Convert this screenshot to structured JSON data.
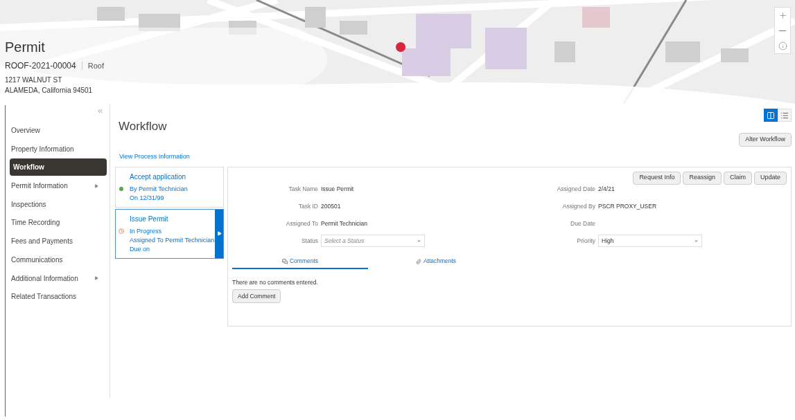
{
  "header": {
    "title": "Permit",
    "permit_number": "ROOF-2021-00004",
    "permit_type": "Roof",
    "address_line_1": "1217 WALNUT ST",
    "address_line_2": "ALAMEDA, California 94501"
  },
  "map_controls": [
    {
      "kind": "zoom-in"
    },
    {
      "kind": "zoom-out"
    },
    {
      "kind": "info"
    }
  ],
  "sidebar": {
    "items": [
      {
        "label": "Overview",
        "selected": false,
        "has_submenu": false
      },
      {
        "label": "Property Information",
        "selected": false,
        "has_submenu": false
      },
      {
        "label": "Workflow",
        "selected": true,
        "has_submenu": false
      },
      {
        "label": "Permit Information",
        "selected": false,
        "has_submenu": true
      },
      {
        "label": "Inspections",
        "selected": false,
        "has_submenu": false
      },
      {
        "label": "Time Recording",
        "selected": false,
        "has_submenu": false
      },
      {
        "label": "Fees and Payments",
        "selected": false,
        "has_submenu": false
      },
      {
        "label": "Communications",
        "selected": false,
        "has_submenu": false
      },
      {
        "label": "Additional Information",
        "selected": false,
        "has_submenu": true
      },
      {
        "label": "Related Transactions",
        "selected": false,
        "has_submenu": false
      }
    ]
  },
  "view_toggle": [
    {
      "kind": "columns",
      "selected": true
    },
    {
      "kind": "list",
      "selected": false
    }
  ],
  "page_title": "Workflow",
  "alter_button": "Alter Workflow",
  "process_link": "View Process Information",
  "steps": [
    {
      "title": "Accept application",
      "kind": "done",
      "lines": [
        "By Permit Technician",
        "On 12/31/99"
      ],
      "selected": false
    },
    {
      "title": "Issue Permit",
      "kind": "in-progress",
      "lines": [
        "In Progress",
        "Assigned To Permit Technician",
        "Due on"
      ],
      "selected": true
    }
  ],
  "task_buttons": [
    "Request Info",
    "Reassign",
    "Claim",
    "Update"
  ],
  "fields_left": [
    {
      "label": "Task Name",
      "kind": "text",
      "value": "Issue Permit"
    },
    {
      "label": "Task ID",
      "kind": "text",
      "value": "200501"
    },
    {
      "label": "Assigned To",
      "kind": "text",
      "value": "Permit Technician"
    },
    {
      "label": "Status",
      "kind": "select",
      "placeholder": "Select a Status"
    }
  ],
  "fields_right": [
    {
      "label": "Assigned Date",
      "kind": "text",
      "value": "2/4/21"
    },
    {
      "label": "Assigned By",
      "kind": "text",
      "value": "PSCR PROXY_USER"
    },
    {
      "label": "Due Date",
      "kind": "text"
    },
    {
      "label": "Priority",
      "kind": "select",
      "value": "High"
    }
  ],
  "tabs": [
    {
      "label": "Comments",
      "kind": "comments",
      "selected": true
    },
    {
      "label": "Attachments",
      "kind": "attachments",
      "selected": false
    }
  ],
  "empty_message": "There are no comments entered.",
  "add_button": "Add Comment"
}
